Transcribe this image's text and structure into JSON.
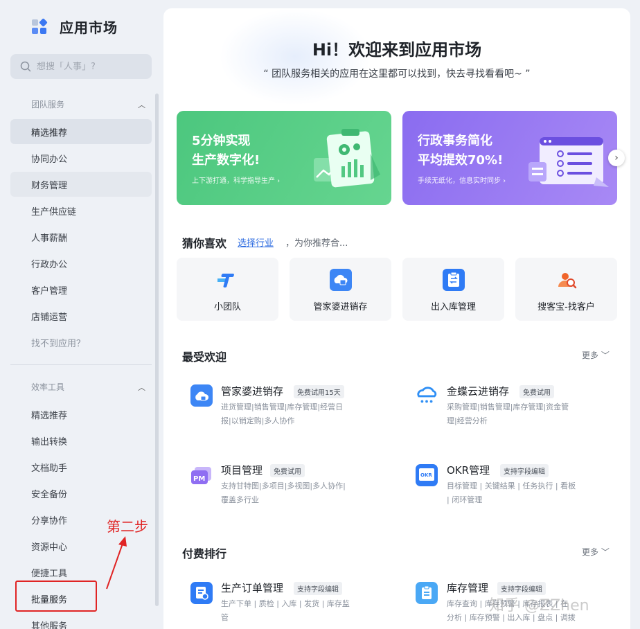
{
  "brand": {
    "title": "应用市场"
  },
  "search": {
    "placeholder": "想搜「人事」?"
  },
  "sidebar": {
    "team_section": "团队服务",
    "team_items": [
      "精选推荐",
      "协同办公",
      "财务管理",
      "生产供应链",
      "人事薪酬",
      "行政办公",
      "客户管理",
      "店铺运营",
      "找不到应用？"
    ],
    "tools_section": "效率工具",
    "tool_items": [
      "精选推荐",
      "输出转换",
      "文档助手",
      "安全备份",
      "分享协作",
      "资源中心",
      "便捷工具",
      "批量服务",
      "其他服务"
    ]
  },
  "annotation": {
    "step": "第二步"
  },
  "hero": {
    "title": "Hi！欢迎来到应用市场",
    "subtitle": "“ 团队服务相关的应用在这里都可以找到，快去寻找看看吧~ ”"
  },
  "banners": [
    {
      "line1": "5分钟实现",
      "line2": "生产数字化!",
      "sub": "上下游打通，科学指导生产 ›",
      "color": "#52c882"
    },
    {
      "line1": "行政事务简化",
      "line2": "平均提效70%!",
      "sub": "手续无纸化，信息实时同步 ›",
      "color": "#9175f2"
    }
  ],
  "guess": {
    "title": "猜你喜欢",
    "link": "选择行业",
    "rest": "，为你推荐合...",
    "items": [
      "小团队",
      "管家婆进销存",
      "出入库管理",
      "搜客宝-找客户"
    ]
  },
  "popular": {
    "title": "最受欢迎",
    "more": "更多",
    "apps": [
      {
        "name": "管家婆进销存",
        "badge": "免费试用15天",
        "desc1": "进货管理|销售管理|库存管理|经营日",
        "desc2": "报|以销定购|多人协作"
      },
      {
        "name": "金蝶云进销存",
        "badge": "免费试用",
        "desc1": "采购管理|销售管理|库存管理|资金管",
        "desc2": "理|经营分析"
      },
      {
        "name": "项目管理",
        "badge": "免费试用",
        "desc1": "支持甘特图|多项目|多视图|多人协作|",
        "desc2": "覆盖多行业"
      },
      {
        "name": "OKR管理",
        "badge": "支持字段编辑",
        "desc1": "目标管理 | 关键结果 | 任务执行 | 看板",
        "desc2": "| 闭环管理"
      }
    ]
  },
  "paid": {
    "title": "付费排行",
    "more": "更多",
    "apps": [
      {
        "name": "生产订单管理",
        "badge": "支持字段编辑",
        "desc1": "生产下单 | 质检 | 入库 | 发货 | 库存监",
        "desc2": "管"
      },
      {
        "name": "库存管理",
        "badge": "支持字段编辑",
        "desc1": "库存查询 | 库存预警 | 库存报表 | 在",
        "desc2": "分析 | 库存预警 | 出入库 | 盘点 | 调拨"
      }
    ]
  },
  "watermark": "知乎 @ZZhen",
  "colors": {
    "accent": "#2c6be0",
    "green": "#52c882",
    "purple": "#9175f2",
    "highlight": "#e02424"
  }
}
